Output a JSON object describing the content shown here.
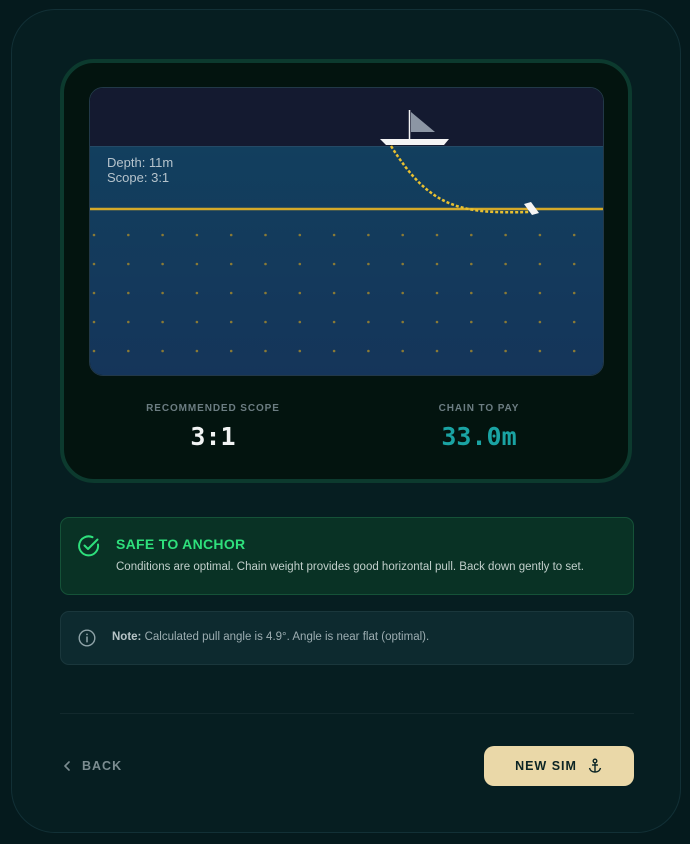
{
  "simulation": {
    "depth_text": "Depth: 11m",
    "scope_text": "Scope: 3:1"
  },
  "stats": {
    "recommended_scope_label": "RECOMMENDED SCOPE",
    "recommended_scope_value": "3:1",
    "chain_to_pay_label": "CHAIN TO PAY",
    "chain_to_pay_value": "33.0m"
  },
  "status": {
    "title": "SAFE TO ANCHOR",
    "description": "Conditions are optimal. Chain weight provides good horizontal pull. Back down gently to set."
  },
  "note": {
    "label": "Note:",
    "text": " Calculated pull angle is 4.9°. Angle is near flat (optimal)."
  },
  "actions": {
    "back_label": "BACK",
    "new_sim_label": "NEW SIM"
  },
  "icons": {
    "status": "check-circle-icon",
    "note": "info-icon",
    "back": "chevron-left-icon",
    "new_sim": "anchor-icon"
  },
  "colors": {
    "safe": "#2ee07c",
    "chain_value": "#1aa3a3",
    "accent_button": "#ead8a8",
    "seabed": "#d4a92a"
  }
}
